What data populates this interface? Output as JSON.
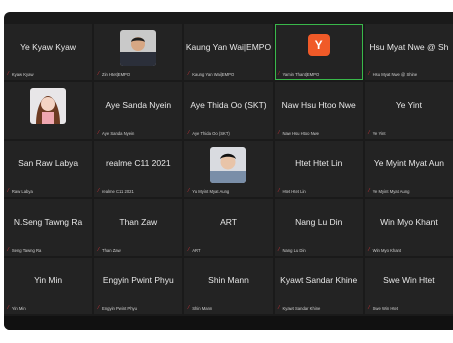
{
  "participants": [
    {
      "name": "Ye Kyaw Kyaw",
      "label": "Kyaw Kyaw",
      "type": "name"
    },
    {
      "name": "",
      "label": "Zin Htet|EMPO",
      "type": "photo",
      "photo": "man-suit"
    },
    {
      "name": "Kaung Yan Wai|EMPO",
      "label": "Kaung Yan Wai|EMPO",
      "type": "name"
    },
    {
      "name": "",
      "label": "Yamin Thant|EMPO",
      "type": "logo",
      "logo_letter": "Y"
    },
    {
      "name": "Hsu Myat Nwe @ Sh",
      "label": "Hsu Myat Nwe @ Shine",
      "type": "name"
    },
    {
      "name": "",
      "label": "",
      "type": "photo",
      "photo": "woman-cartoon"
    },
    {
      "name": "Aye Sanda Nyein",
      "label": "Aye Sanda Nyein",
      "type": "name"
    },
    {
      "name": "Aye Thida Oo (SKT)",
      "label": "Aye Thida Oo (SKT)",
      "type": "name"
    },
    {
      "name": "Naw Hsu Htoo Nwe",
      "label": "Naw Hsu Htoo Nwe",
      "type": "name"
    },
    {
      "name": "Ye Yint",
      "label": "Ye Yint",
      "type": "name"
    },
    {
      "name": "San Raw Labya",
      "label": "Raw Labya",
      "type": "name"
    },
    {
      "name": "realme C11 2021",
      "label": "realme C11 2021",
      "type": "name"
    },
    {
      "name": "",
      "label": "Yu Myint Myat Aung",
      "type": "photo",
      "photo": "man-photo"
    },
    {
      "name": "Htet Htet Lin",
      "label": "Htet Htet Lin",
      "type": "name"
    },
    {
      "name": "Ye Myint Myat Aun",
      "label": "Ye Myint Myat Aung",
      "type": "name"
    },
    {
      "name": "N.Seng Tawng Ra",
      "label": "Seng Tawng Ra",
      "type": "name"
    },
    {
      "name": "Than Zaw",
      "label": "Than Zaw",
      "type": "name"
    },
    {
      "name": "ART",
      "label": "ART",
      "type": "name"
    },
    {
      "name": "Nang Lu Din",
      "label": "Nang Lu Din",
      "type": "name"
    },
    {
      "name": "Win Myo Khant",
      "label": "Win Myo Khant",
      "type": "name"
    },
    {
      "name": "Yin Min",
      "label": "Yin Min",
      "type": "name"
    },
    {
      "name": "Engyin Pwint Phyu",
      "label": "Engyin Pwint Phyu",
      "type": "name"
    },
    {
      "name": "Shin Mann",
      "label": "Shin Mann",
      "type": "name"
    },
    {
      "name": "Kyawt Sandar Khine",
      "label": "Kyawt Sandar Khine",
      "type": "name"
    },
    {
      "name": "Swe Win Htet",
      "label": "Swe Win Htet",
      "type": "name"
    }
  ],
  "active_index": 3,
  "colors": {
    "active_border": "#39b84a",
    "mic_muted": "#e0343a",
    "logo_bg": "#f05a28"
  }
}
